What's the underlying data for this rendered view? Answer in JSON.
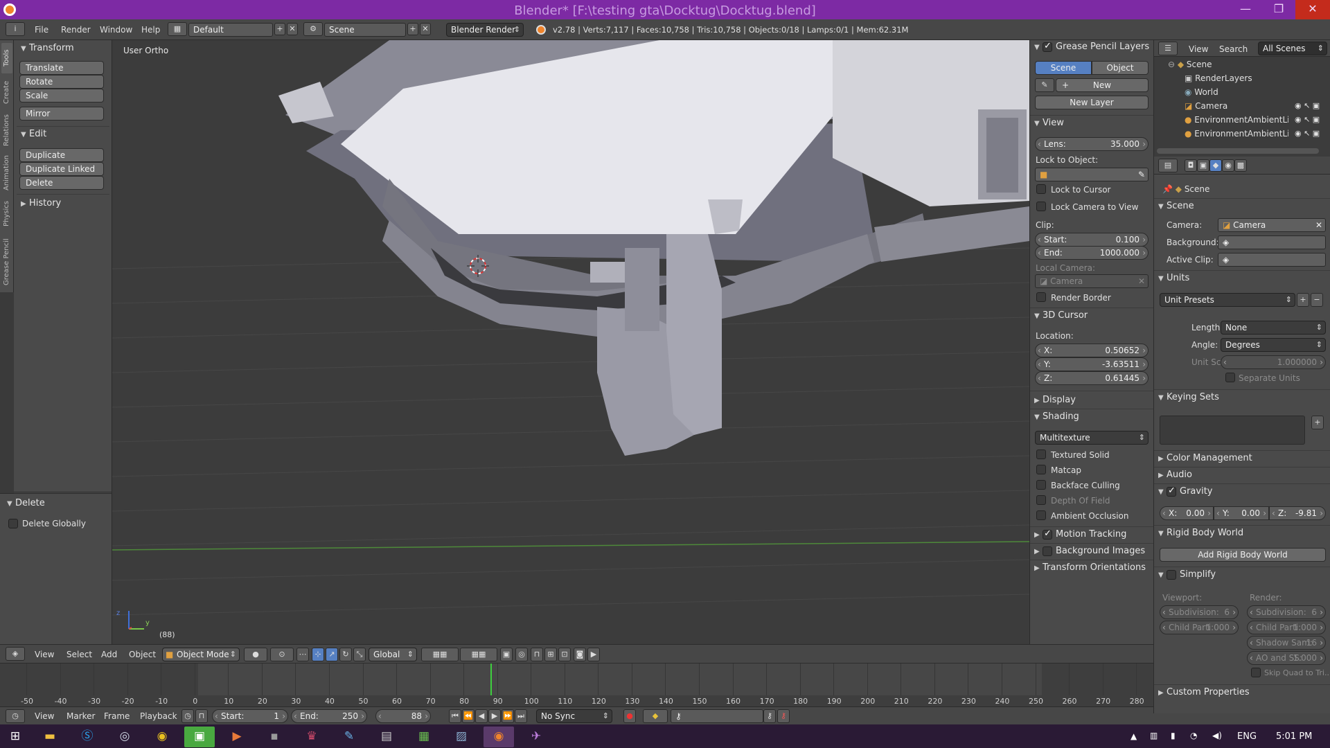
{
  "window": {
    "title": "Blender* [F:\\testing gta\\Docktug\\Docktug.blend]",
    "minimize": "—",
    "maximize": "❐",
    "close": "✕"
  },
  "menubar": {
    "info_icon": "i",
    "menus": [
      "File",
      "Render",
      "Window",
      "Help"
    ],
    "layout": "Default",
    "scene": "Scene",
    "engine": "Blender Render",
    "stats": "v2.78 | Verts:7,117 | Faces:10,758 | Tris:10,758 | Objects:0/18 | Lamps:0/1 | Mem:62.31M"
  },
  "tool_tabs": [
    "Tools",
    "Create",
    "Relations",
    "Animation",
    "Physics",
    "Grease Pencil"
  ],
  "toolshelf": {
    "transform": {
      "header": "Transform",
      "buttons": [
        "Translate",
        "Rotate",
        "Scale",
        "Mirror"
      ]
    },
    "edit": {
      "header": "Edit",
      "buttons": [
        "Duplicate",
        "Duplicate Linked",
        "Delete"
      ]
    },
    "history": {
      "header": "History"
    },
    "operator": {
      "header": "Delete",
      "option": "Delete Globally"
    }
  },
  "viewport": {
    "view_label": "User Ortho",
    "frame": "(88)",
    "axis_x": "x",
    "axis_y": "y",
    "axis_z": "z"
  },
  "properties_panel": {
    "grease_pencil": {
      "header": "Grease Pencil Layers",
      "tab_scene": "Scene",
      "tab_object": "Object",
      "new": "New",
      "new_layer": "New Layer"
    },
    "view": {
      "header": "View",
      "lens_label": "Lens:",
      "lens_value": "35.000",
      "lock_object": "Lock to Object:",
      "lock_cursor": "Lock to Cursor",
      "lock_camera": "Lock Camera to View",
      "clip": "Clip:",
      "clip_start_label": "Start:",
      "clip_start": "0.100",
      "clip_end_label": "End:",
      "clip_end": "1000.000",
      "local_camera": "Local Camera:",
      "camera": "Camera",
      "render_border": "Render Border"
    },
    "cursor": {
      "header": "3D Cursor",
      "location": "Location:",
      "x_label": "X:",
      "x": "0.50652",
      "y_label": "Y:",
      "y": "-3.63511",
      "z_label": "Z:",
      "z": "0.61445"
    },
    "display": {
      "header": "Display"
    },
    "shading": {
      "header": "Shading",
      "mode": "Multitexture",
      "options": [
        "Textured Solid",
        "Matcap",
        "Backface Culling",
        "Depth Of Field",
        "Ambient Occlusion"
      ]
    },
    "motion_tracking": "Motion Tracking",
    "background_images": "Background Images",
    "transform_orientations": "Transform Orientations"
  },
  "outliner": {
    "menus": [
      "View",
      "Search"
    ],
    "filter": "All Scenes",
    "items": [
      "Scene",
      "RenderLayers",
      "World",
      "Camera",
      "EnvironmentAmbientLi",
      "EnvironmentAmbientLi"
    ]
  },
  "scene_props": {
    "breadcrumb": "Scene",
    "scene": {
      "header": "Scene",
      "camera_label": "Camera:",
      "camera": "Camera",
      "background_label": "Background:",
      "clip_label": "Active Clip:"
    },
    "units": {
      "header": "Units",
      "presets": "Unit Presets",
      "length_label": "Length:",
      "length": "None",
      "angle_label": "Angle:",
      "angle": "Degrees",
      "scale_label": "Unit Scale:",
      "scale": "1.000000",
      "separate": "Separate Units"
    },
    "keying": {
      "header": "Keying Sets"
    },
    "color_management": "Color Management",
    "audio": "Audio",
    "gravity": {
      "header": "Gravity",
      "x_label": "X:",
      "x": "0.00",
      "y_label": "Y:",
      "y": "0.00",
      "z_label": "Z:",
      "z": "-9.81"
    },
    "rigid_body": {
      "header": "Rigid Body World",
      "button": "Add Rigid Body World"
    },
    "simplify": {
      "header": "Simplify",
      "viewport": "Viewport:",
      "render": "Render:",
      "vp_subdiv_label": "Subdivision:",
      "vp_subdiv": "6",
      "vp_child_label": "Child Parti:",
      "vp_child": "1.000",
      "r_subdiv_label": "Subdivision:",
      "r_subdiv": "6",
      "r_child_label": "Child Parti:",
      "r_child": "1.000",
      "shadow_label": "Shadow Sam:",
      "shadow": "16",
      "ao_label": "AO and SS:",
      "ao": "1.000",
      "skip_quad": "Skip Quad to Tri..."
    },
    "custom": "Custom Properties"
  },
  "viewport_header": {
    "menus": [
      "View",
      "Select",
      "Add",
      "Object"
    ],
    "mode": "Object Mode",
    "orientation": "Global"
  },
  "timeline": {
    "ticks": [
      "-50",
      "-40",
      "-30",
      "-20",
      "-10",
      "0",
      "10",
      "20",
      "30",
      "40",
      "50",
      "60",
      "70",
      "80",
      "90",
      "100",
      "110",
      "120",
      "130",
      "140",
      "150",
      "160",
      "170",
      "180",
      "190",
      "200",
      "210",
      "220",
      "230",
      "240",
      "250",
      "260",
      "270",
      "280"
    ],
    "current_frame": 88,
    "menus": [
      "View",
      "Marker",
      "Frame",
      "Playback"
    ],
    "start_label": "Start:",
    "start": "1",
    "end_label": "End:",
    "end": "250",
    "current": "88",
    "sync": "No Sync"
  },
  "taskbar": {
    "lang": "ENG",
    "time": "5:01 PM"
  }
}
